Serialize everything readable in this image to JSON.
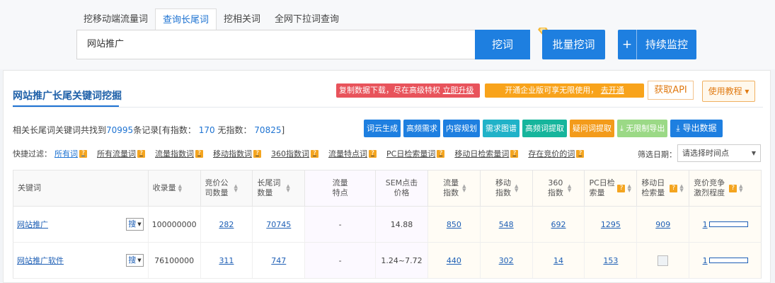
{
  "tabs": [
    "挖移动端流量词",
    "查询长尾词",
    "挖相关词",
    "全网下拉词查询"
  ],
  "search": {
    "value": "网站推广"
  },
  "buttons": {
    "dig": "挖词",
    "batch": "批量挖词",
    "plus": "+",
    "monitor": "持续监控"
  },
  "panel": {
    "title": "网站推广长尾关键词挖掘",
    "promo1_text": "复制数据下载，尽在高级特权",
    "promo1_link": "立即升级",
    "promo2_text": "开通企业版可享无限使用，",
    "promo2_link": "去开通",
    "api": "获取API",
    "tutorial": "使用教程 ▾"
  },
  "found": {
    "prefix": "相关长尾词关键词共找到",
    "total": "70995",
    "mid": "条记录[有指数：",
    "with_index": "170",
    "mid2": "无指数：",
    "without_index": "70825",
    "suffix": "]"
  },
  "tool_buttons": [
    "词云生成",
    "高频需求",
    "内容规划",
    "需求图谱",
    "高频词提取",
    "疑问词提取",
    "无限制导出",
    "导出数据"
  ],
  "filters": {
    "label": "快捷过滤：",
    "items": [
      "所有词",
      "所有流量词",
      "流量指数词",
      "移动指数词",
      "360指数词",
      "流量特点词",
      "PC日检索量词",
      "移动日检索量词",
      "存在竞价的词"
    ]
  },
  "date": {
    "label": "筛选日期：",
    "placeholder": "请选择时间点"
  },
  "table": {
    "headers": [
      "关键词",
      "收录量",
      "竞价公司数量",
      "长尾词数量",
      "流量特点",
      "SEM点击价格",
      "流量指数",
      "移动指数",
      "360指数",
      "PC日检索量",
      "移动日检索量",
      "竞价竞争激烈程度"
    ],
    "rows": [
      {
        "keyword": "网站推广",
        "sou": "搜",
        "shoulu": "100000000",
        "company": "282",
        "longtail": "70745",
        "feature": "-",
        "sem": "14.88",
        "flow": "850",
        "mobile": "548",
        "s360": "692",
        "pc_daily": "1295",
        "mobile_daily": "909",
        "competition": "1"
      },
      {
        "keyword": "网站推广软件",
        "sou": "搜",
        "shoulu": "76100000",
        "company": "311",
        "longtail": "747",
        "feature": "-",
        "sem": "1.24~7.72",
        "flow": "440",
        "mobile": "302",
        "s360": "14",
        "pc_daily": "153",
        "mobile_daily": "",
        "competition": "1"
      }
    ]
  },
  "colors": {
    "accent": "#1e7fe0",
    "promo_red": "#e8535b",
    "promo_orange": "#f8a31b",
    "link": "#1e5fb5"
  }
}
